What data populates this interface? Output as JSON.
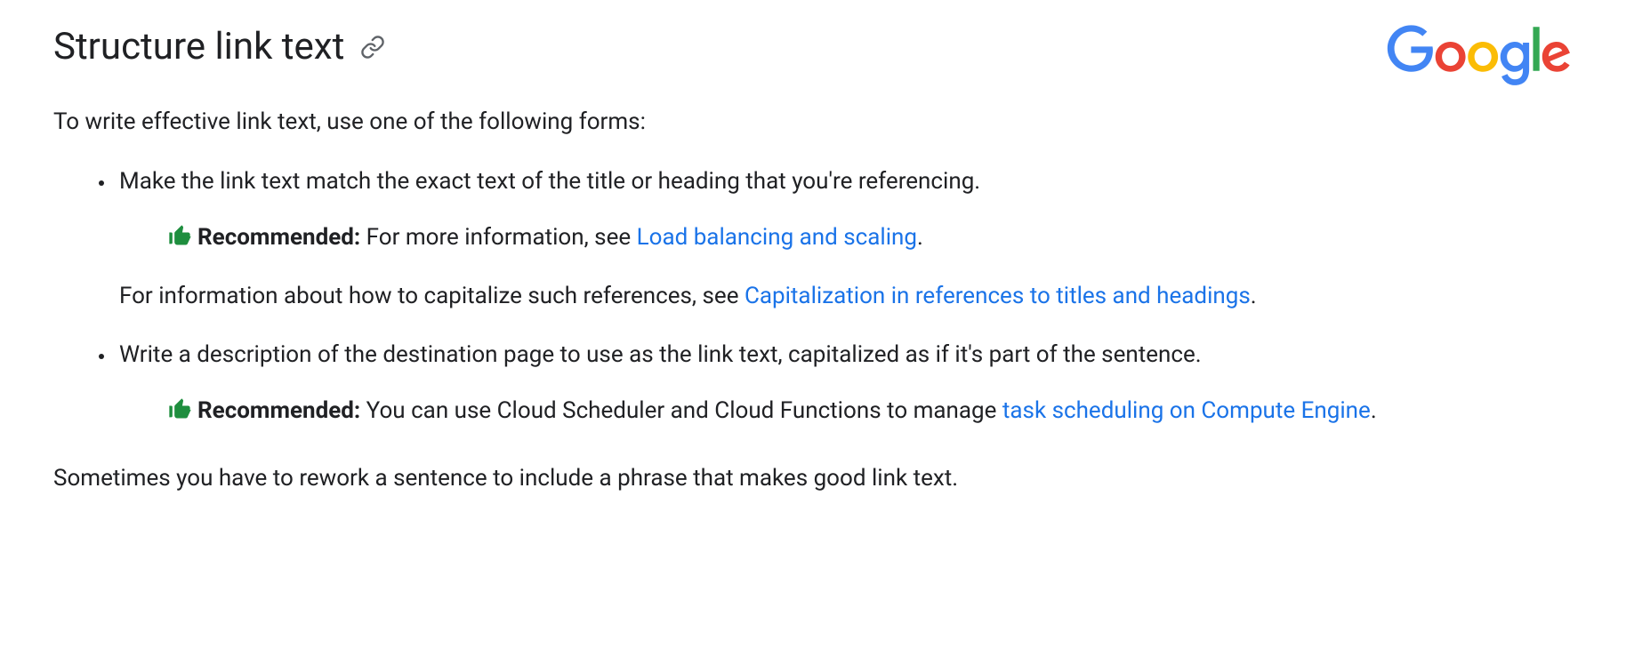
{
  "heading": "Structure link text",
  "intro": "To write effective link text, use one of the following forms:",
  "list": {
    "item1": {
      "text": "Make the link text match the exact text of the title or heading that you're referencing.",
      "callout": {
        "label": "Recommended:",
        "before": " For more information, see ",
        "link": "Load balancing and scaling",
        "after": "."
      },
      "followup": {
        "before": "For information about how to capitalize such references, see ",
        "link": "Capitalization in references to titles and headings",
        "after": "."
      }
    },
    "item2": {
      "text": "Write a description of the destination page to use as the link text, capitalized as if it's part of the sentence.",
      "callout": {
        "label": "Recommended:",
        "before": " You can use Cloud Scheduler and Cloud Functions to manage ",
        "link": "task scheduling on Compute Engine",
        "after": "."
      }
    }
  },
  "outro": "Sometimes you have to rework a sentence to include a phrase that makes good link text.",
  "logo_alt": "Google"
}
